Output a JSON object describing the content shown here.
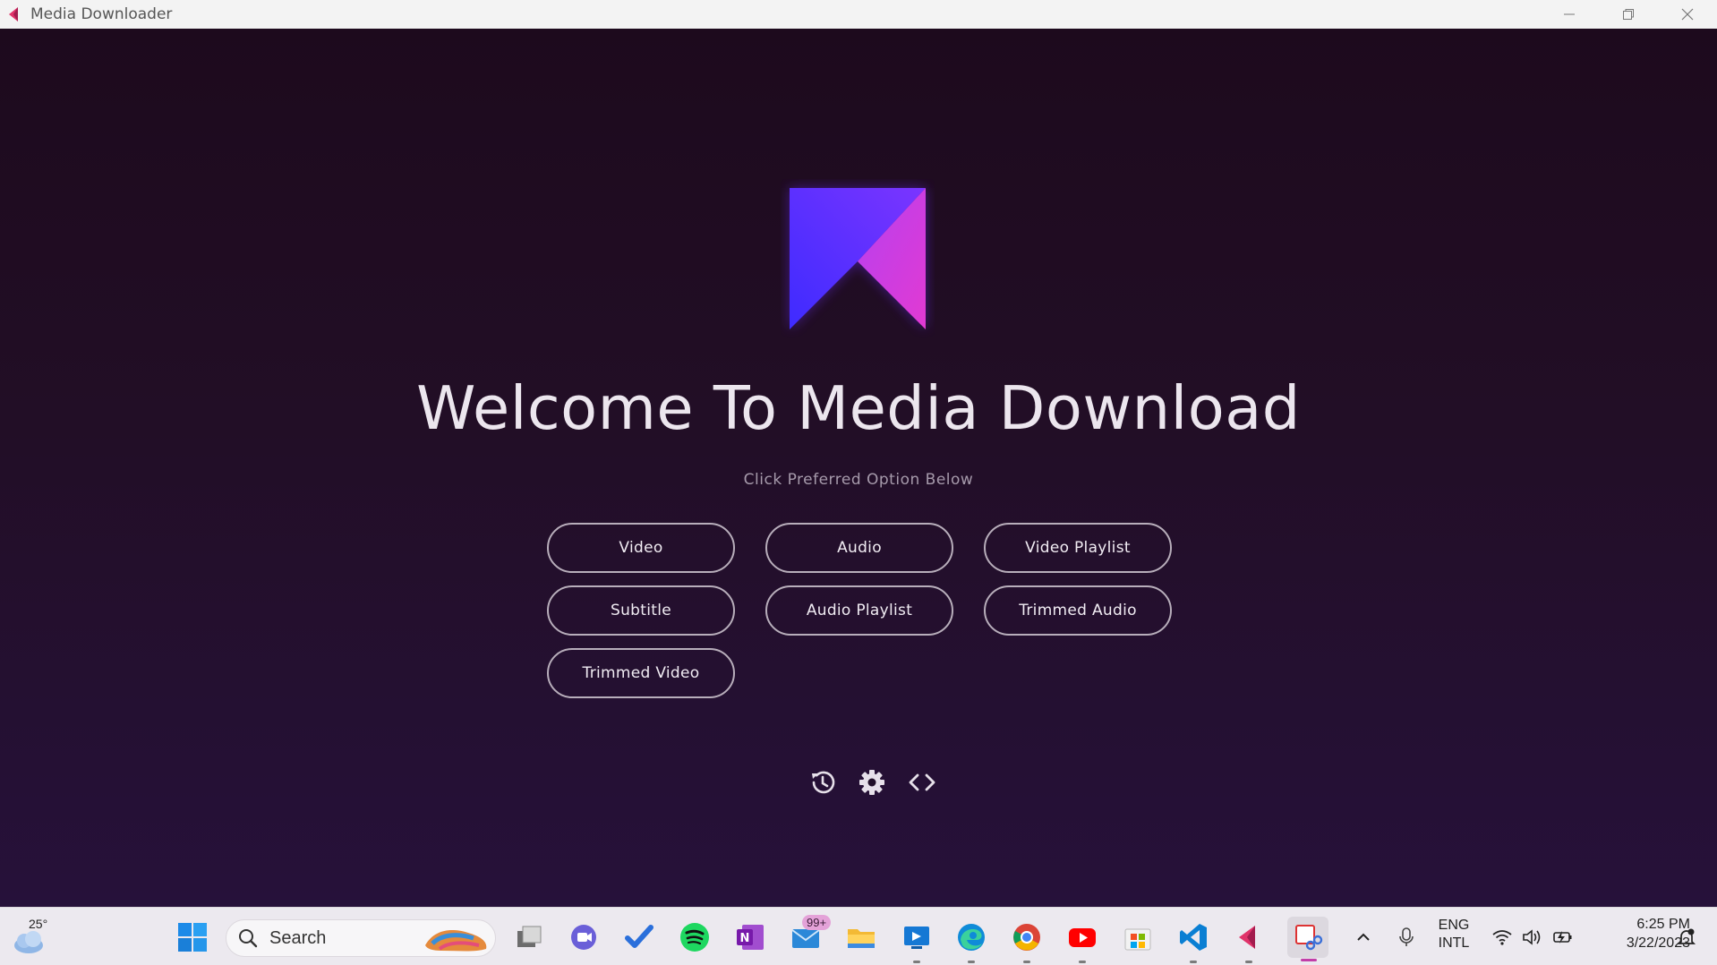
{
  "window": {
    "title": "Media Downloader"
  },
  "main": {
    "heading": "Welcome To Media Download",
    "subheading": "Click Preferred Option Below",
    "options": [
      {
        "label": "Video"
      },
      {
        "label": "Audio"
      },
      {
        "label": "Video Playlist"
      },
      {
        "label": "Subtitle"
      },
      {
        "label": "Audio Playlist"
      },
      {
        "label": "Trimmed Audio"
      },
      {
        "label": "Trimmed Video"
      }
    ],
    "tools": [
      "history-icon",
      "gear-icon",
      "code-icon"
    ]
  },
  "taskbar": {
    "weather_temp": "25°",
    "search_label": "Search",
    "mail_badge": "99+",
    "lang_line1": "ENG",
    "lang_line2": "INTL",
    "time": "6:25 PM",
    "date": "3/22/2023"
  },
  "colors": {
    "accent_purple": "#6a2cff",
    "accent_pink": "#d13be0",
    "button_border": "#b8aebb"
  }
}
